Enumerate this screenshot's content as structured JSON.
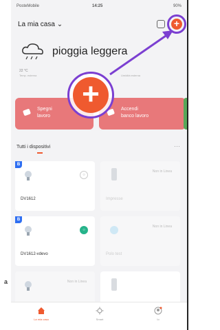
{
  "status_bar": {
    "carrier": "PosteMobile",
    "time": "14:25",
    "battery": "90%"
  },
  "header": {
    "home_title": "La mia casa ⌄",
    "add_symbol": "+"
  },
  "weather": {
    "condition": "pioggia leggera",
    "temperature": "22 °C",
    "temperature_caption": "Temp. esterna",
    "humidity_caption": "Umidità esterna",
    "icon": "rain-cloud-icon"
  },
  "scenes": [
    {
      "label_line1": "Spegni",
      "label_line2": "lavoro",
      "color": "#e8787a"
    },
    {
      "label_line1": "Accendi",
      "label_line2": "banco lavoro",
      "color": "#e8787a"
    }
  ],
  "devices": {
    "heading": "Tutti i dispositivi",
    "more": "···",
    "items": [
      {
        "name": "DV1612",
        "badge": "B",
        "status": "",
        "power": "○"
      },
      {
        "name": "Impresse",
        "badge": "",
        "status": "Non in Linea",
        "power": ""
      },
      {
        "name": "DV1612-vdevo",
        "badge": "B",
        "status": "",
        "power": "○"
      },
      {
        "name": "Polo test",
        "badge": "",
        "status": "Non in Linea",
        "power": ""
      },
      {
        "name": "",
        "badge": "",
        "status": "Non in Linea",
        "power": ""
      },
      {
        "name": "",
        "badge": "",
        "status": "",
        "power": ""
      }
    ]
  },
  "tabbar": {
    "tabs": [
      {
        "label": "La mia casa",
        "icon": "home-icon",
        "active": true
      },
      {
        "label": "Smart",
        "icon": "sun-icon",
        "active": false
      },
      {
        "label": "Io",
        "icon": "profile-icon",
        "active": false
      }
    ]
  },
  "overlay": {
    "big_plus": "+"
  },
  "outside_letter": "a",
  "colors": {
    "accent": "#ef5a2f",
    "highlight": "#7b3fd1",
    "scene": "#e8787a",
    "online_power": "#26b38a",
    "badge": "#2f6ff2"
  }
}
